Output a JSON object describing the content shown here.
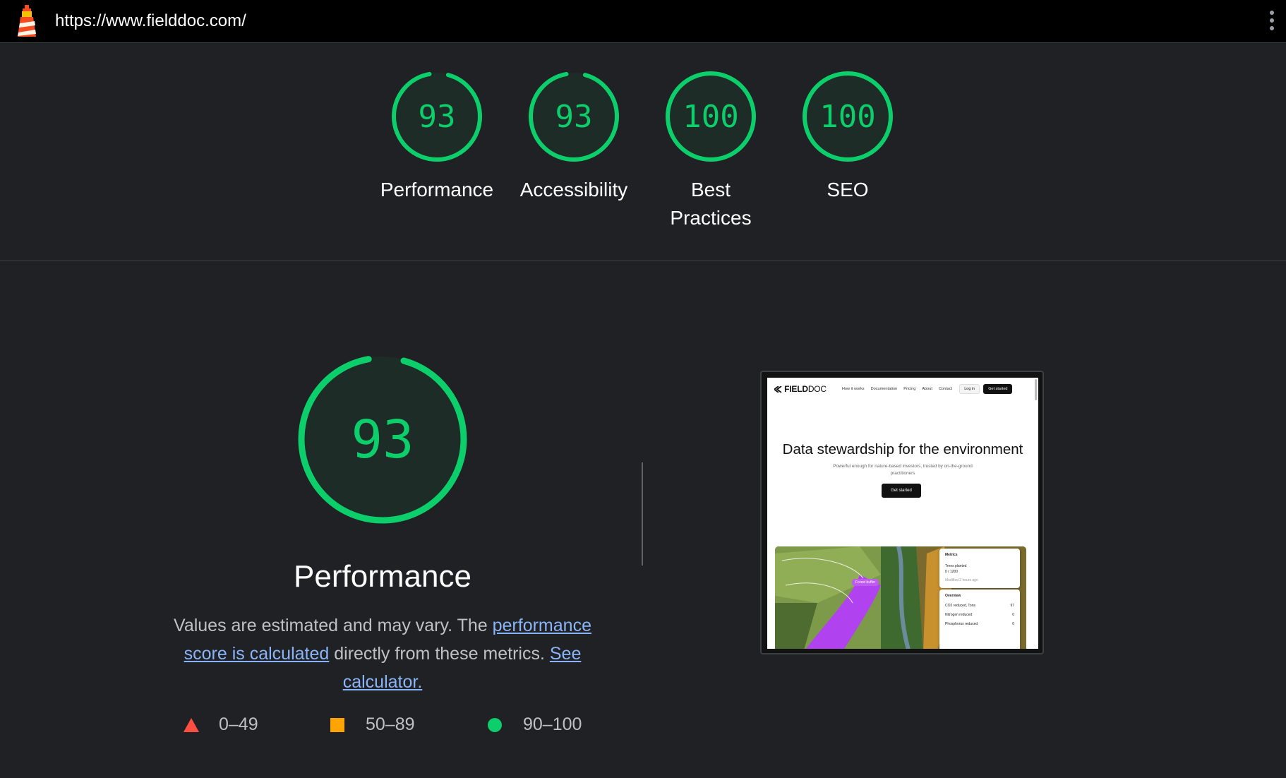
{
  "browser": {
    "url": "https://www.fielddoc.com/",
    "logo_icon": "lighthouse-icon",
    "menu_icon": "kebab-menu-icon"
  },
  "summary": {
    "categories": [
      {
        "label": "Performance",
        "score": "93",
        "fraction": 0.93
      },
      {
        "label": "Accessibility",
        "score": "93",
        "fraction": 0.93
      },
      {
        "label": "Best Practices",
        "score": "100",
        "fraction": 1.0
      },
      {
        "label": "SEO",
        "score": "100",
        "fraction": 1.0
      }
    ]
  },
  "performance": {
    "score": "93",
    "fraction": 0.93,
    "title": "Performance",
    "desc_prefix": "Values are estimated and may vary. The ",
    "desc_link1": "performance score is calculated",
    "desc_middle": " directly from these metrics. ",
    "desc_link2": "See calculator.",
    "legend": [
      {
        "icon": "triangle-fail-icon",
        "range": "0–49"
      },
      {
        "icon": "square-average-icon",
        "range": "50–89"
      },
      {
        "icon": "circle-pass-icon",
        "range": "90–100"
      }
    ]
  },
  "screenshot": {
    "logo_strong": "FIELD",
    "logo_thin": "DOC",
    "nav": [
      "How it works",
      "Documentation",
      "Pricing",
      "About",
      "Contact"
    ],
    "login": "Log in",
    "get_started": "Get started",
    "hero_title": "Data stewardship for the environment",
    "hero_sub": "Powerful enough for nature-based investors, trusted by on-the-ground practitioners",
    "hero_button": "Get started",
    "map_pill": "Forest buffer",
    "card_metrics": {
      "title": "Metrics",
      "line1": "Trees planted",
      "value": "0 / 1200",
      "updated": "Modified 2 hours ago"
    },
    "card_overview": {
      "title": "Overview",
      "rows": [
        {
          "label": "CO2 reduced, Tons",
          "value": "97"
        },
        {
          "label": "Nitrogen reduced",
          "value": "0"
        },
        {
          "label": "Phosphorus reduced",
          "value": "0"
        }
      ]
    }
  },
  "colors": {
    "pass": "#0cce6b",
    "average": "#ffa400",
    "fail": "#ff4e42",
    "link": "#8ab4f8",
    "background": "#202124"
  }
}
